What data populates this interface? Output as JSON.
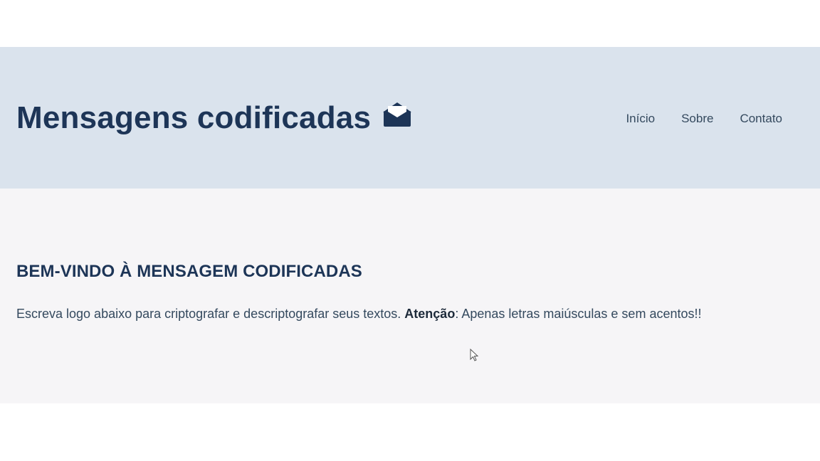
{
  "header": {
    "title": "Mensagens codificadas",
    "logo_icon": "envelope-open-icon",
    "nav": [
      {
        "label": "Início"
      },
      {
        "label": "Sobre"
      },
      {
        "label": "Contato"
      }
    ]
  },
  "intro": {
    "heading": "BEM-VINDO À MENSAGEM CODIFICADAS",
    "text_before": "Escreva logo abaixo para criptografar e descriptografar seus textos. ",
    "text_bold": "Atenção",
    "text_after": ": Apenas letras maiúsculas e sem acentos!!"
  },
  "colors": {
    "header_bg": "#dae3ed",
    "primary": "#1d3557",
    "content_bg": "#f6f5f7"
  }
}
